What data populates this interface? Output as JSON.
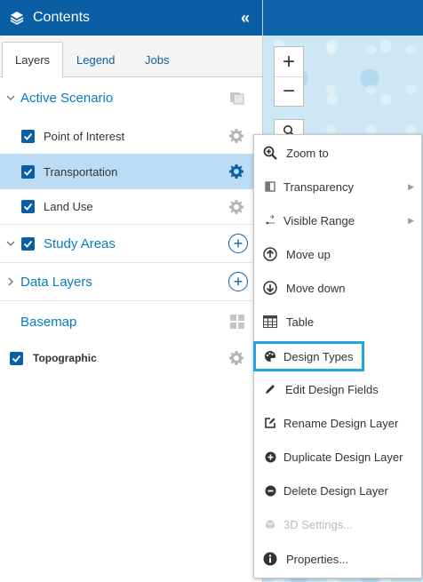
{
  "panel": {
    "title": "Contents",
    "collapse_glyph": "«",
    "tabs": [
      {
        "label": "Layers",
        "active": true
      },
      {
        "label": "Legend",
        "active": false
      },
      {
        "label": "Jobs",
        "active": false
      }
    ]
  },
  "tree": {
    "active_scenario": {
      "label": "Active Scenario"
    },
    "layers": [
      {
        "label": "Point of Interest",
        "checked": true,
        "selected": false
      },
      {
        "label": "Transportation",
        "checked": true,
        "selected": true
      },
      {
        "label": "Land Use",
        "checked": true,
        "selected": false
      }
    ],
    "study_areas": {
      "label": "Study Areas",
      "checked": true
    },
    "data_layers": {
      "label": "Data Layers"
    },
    "basemap": {
      "label": "Basemap"
    },
    "topographic": {
      "label": "Topographic",
      "checked": true
    }
  },
  "map": {
    "zoom_in": "+",
    "zoom_out": "−"
  },
  "context_menu": {
    "items": [
      {
        "label": "Zoom to",
        "icon": "zoom-in-icon"
      },
      {
        "label": "Transparency",
        "icon": "transparency-icon",
        "submenu": true
      },
      {
        "label": "Visible Range",
        "icon": "visible-range-icon",
        "submenu": true
      },
      {
        "label": "Move up",
        "icon": "arrow-up-circle-icon"
      },
      {
        "label": "Move down",
        "icon": "arrow-down-circle-icon"
      },
      {
        "label": "Table",
        "icon": "table-icon"
      },
      {
        "label": "Design Types",
        "icon": "palette-icon",
        "highlighted": true
      },
      {
        "label": "Edit Design Fields",
        "icon": "pencil-icon"
      },
      {
        "label": "Rename Design Layer",
        "icon": "rename-icon"
      },
      {
        "label": "Duplicate Design Layer",
        "icon": "plus-circle-icon"
      },
      {
        "label": "Delete Design Layer",
        "icon": "minus-circle-icon"
      },
      {
        "label": "3D Settings...",
        "icon": "cube-icon",
        "disabled": true
      },
      {
        "label": "Properties...",
        "icon": "info-icon"
      }
    ]
  },
  "colors": {
    "header_blue": "#0a5fa4",
    "selected_row": "#bcdcf6",
    "highlight_outline": "#1ea4e0"
  }
}
